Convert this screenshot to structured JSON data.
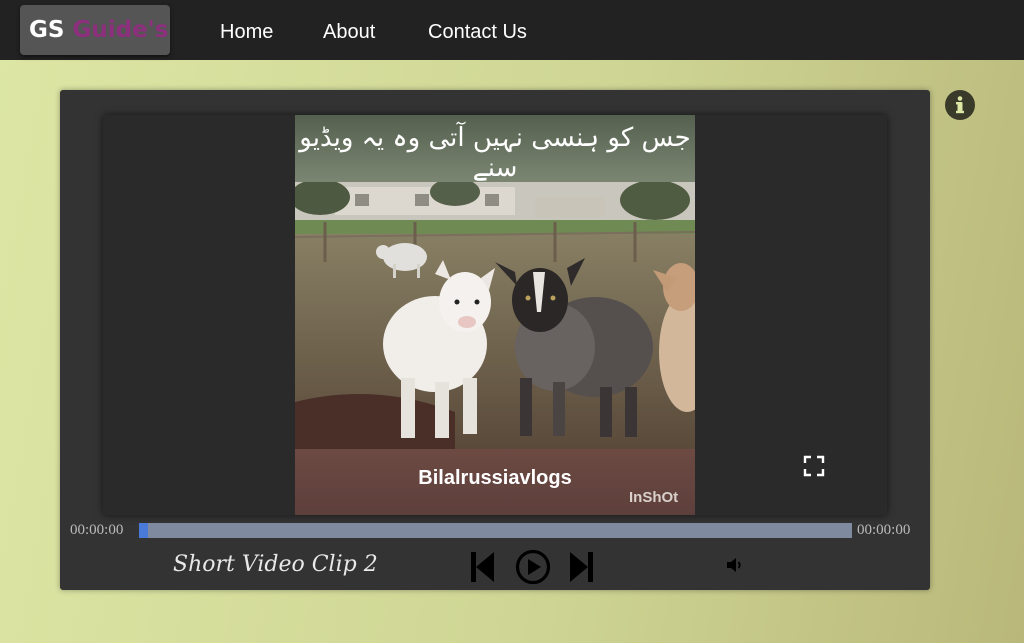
{
  "nav": {
    "logo_part1": "GS",
    "logo_part2": "Guide's",
    "links": [
      "Home",
      "About",
      "Contact Us"
    ]
  },
  "player": {
    "video": {
      "caption": "جس کو ہنسی نہیں آتی وہ یہ ویڈیو سنے",
      "channel": "Bilalrussiavlogs",
      "watermark": "InShOt"
    },
    "current_time": "00:00:00",
    "duration": "00:00:00",
    "progress": 0.0,
    "clip_title": "Short Video Clip 2"
  },
  "icons": {
    "info": "info-circle-icon",
    "fullscreen": "fullscreen-icon",
    "previous": "skip-previous-icon",
    "play": "play-circle-icon",
    "next": "skip-next-icon",
    "volume": "volume-icon"
  },
  "colors": {
    "navbar": "#222222",
    "player_bg": "#333333",
    "progress_track": "#7f8a9e",
    "progress_fill": "#3a66c7",
    "logo_accent": "#8c2f7c"
  }
}
